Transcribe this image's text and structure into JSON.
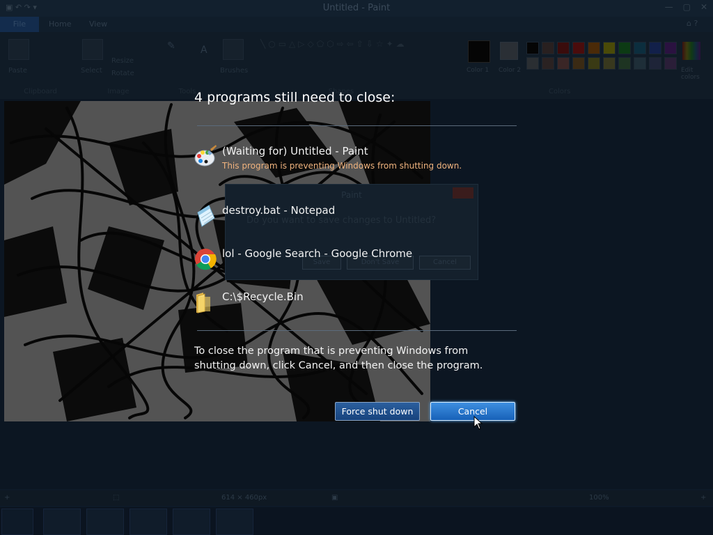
{
  "background_app": {
    "title": "Untitled - Paint",
    "ribbon_tabs": [
      "File",
      "Home",
      "View"
    ],
    "groups": [
      "Clipboard",
      "Image",
      "Tools",
      "Shapes",
      "Colors"
    ],
    "paste_label": "Paste",
    "select_label": "Select",
    "brushes_label": "Brushes",
    "color1_label": "Color 1",
    "color2_label": "Color 2",
    "edit_colors_label": "Edit colors",
    "resize_label": "Resize",
    "rotate_label": "Rotate",
    "status_size": "614 × 460px",
    "zoom": "100%",
    "dialog": {
      "title": "Paint",
      "question": "Do you want to save changes to Untitled?",
      "save": "Save",
      "dont_save": "Don't Save",
      "cancel": "Cancel"
    }
  },
  "shutdown": {
    "heading": "4 programs still need to close:",
    "programs": [
      {
        "name": "(Waiting for) Untitled - Paint",
        "detail": "This program is preventing Windows from shutting down.",
        "icon": "paint-icon"
      },
      {
        "name": "destroy.bat - Notepad",
        "detail": "",
        "icon": "notepad-icon"
      },
      {
        "name": "lol - Google Search - Google Chrome",
        "detail": "",
        "icon": "chrome-icon"
      },
      {
        "name": "C:\\$Recycle.Bin",
        "detail": "",
        "icon": "folder-icon"
      }
    ],
    "message": "To close the program that is preventing Windows from shutting down, click Cancel, and then close the program.",
    "force_button": "Force shut down",
    "cancel_button": "Cancel"
  },
  "colors": {
    "accent": "#1761b8",
    "warning_text": "#f0b37e"
  }
}
